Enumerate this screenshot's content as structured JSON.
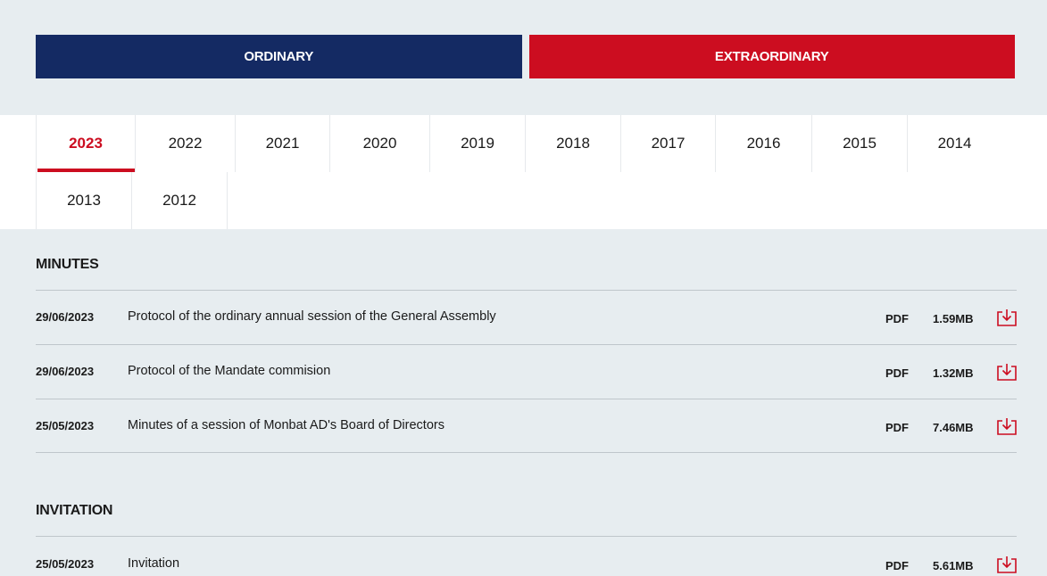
{
  "type_tabs": {
    "ordinary": "ORDINARY",
    "extraordinary": "EXTRAORDINARY"
  },
  "years": {
    "active": "2023",
    "items": [
      "2023",
      "2022",
      "2021",
      "2020",
      "2019",
      "2018",
      "2017",
      "2016",
      "2015",
      "2014",
      "2013",
      "2012"
    ]
  },
  "sections": {
    "minutes": {
      "title": "MINUTES",
      "docs": [
        {
          "date": "29/06/2023",
          "title": "Protocol of the ordinary annual session of the General Assembly",
          "format": "PDF",
          "size": "1.59MB",
          "icon": "download-icon"
        },
        {
          "date": "29/06/2023",
          "title": "Protocol of the Mandate commision",
          "format": "PDF",
          "size": "1.32MB",
          "icon": "download-icon"
        },
        {
          "date": "25/05/2023",
          "title": "Minutes of a session of Monbat AD's Board of Directors",
          "format": "PDF",
          "size": "7.46MB",
          "icon": "download-icon"
        }
      ]
    },
    "invitation": {
      "title": "INVITATION",
      "docs": [
        {
          "date": "25/05/2023",
          "title": "Invitation",
          "format": "PDF",
          "size": "5.61MB",
          "icon": "download-icon"
        }
      ]
    }
  },
  "colors": {
    "navy": "#142a63",
    "red": "#cc0d20",
    "background": "#e7edf0"
  }
}
